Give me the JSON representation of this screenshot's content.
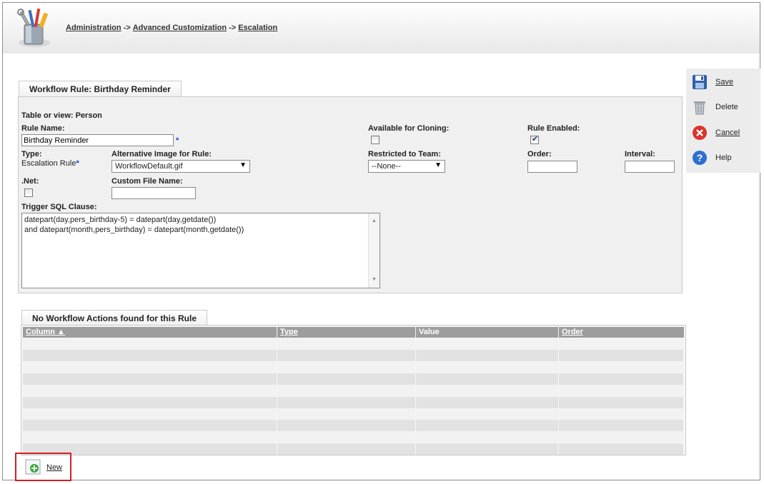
{
  "breadcrumb": {
    "items": [
      "Administration",
      "Advanced Customization",
      "Escalation"
    ],
    "separator": "->"
  },
  "rule_panel": {
    "tab_title": "Workflow Rule: Birthday Reminder",
    "table_label": "Table or view: Person",
    "rule_name_label": "Rule Name:",
    "rule_name_value": "Birthday Reminder",
    "required_marker": "*",
    "available_cloning_label": "Available for Cloning:",
    "available_cloning_checked": false,
    "rule_enabled_label": "Rule Enabled:",
    "rule_enabled_checked": true,
    "type_label": "Type:",
    "type_value": "Escalation Rule",
    "alt_image_label": "Alternative Image for Rule:",
    "alt_image_value": "WorkflowDefault.gif",
    "restricted_team_label": "Restricted to Team:",
    "restricted_team_value": "--None--",
    "order_label": "Order:",
    "order_value": "",
    "interval_label": "Interval:",
    "interval_value": "",
    "dotnet_label": ".Net:",
    "dotnet_checked": false,
    "custom_file_label": "Custom File Name:",
    "custom_file_value": "",
    "trigger_sql_label": "Trigger SQL Clause:",
    "trigger_sql_lines": [
      "datepart(day,pers_birthday-5) = datepart(day,getdate())",
      "and datepart(month,pers_birthday)  = datepart(month,getdate())"
    ]
  },
  "actions_panel": {
    "tab_title": "No Workflow Actions found for this Rule",
    "columns": [
      "Column ▲",
      "Type",
      "Value",
      "Order"
    ],
    "empty_rows": 10
  },
  "sidebar": {
    "items": [
      {
        "label": "Save",
        "icon": "save-icon"
      },
      {
        "label": "Delete",
        "icon": "trash-icon"
      },
      {
        "label": "Cancel",
        "icon": "cancel-icon"
      },
      {
        "label": "Help",
        "icon": "help-icon"
      }
    ]
  },
  "new_button": {
    "label": "New",
    "icon": "new-icon"
  },
  "colors": {
    "grid_header": "#9d9d9d",
    "panel_bg": "#f0f0f0",
    "highlight_border": "#d11f26",
    "required": "#1f3fd6"
  }
}
